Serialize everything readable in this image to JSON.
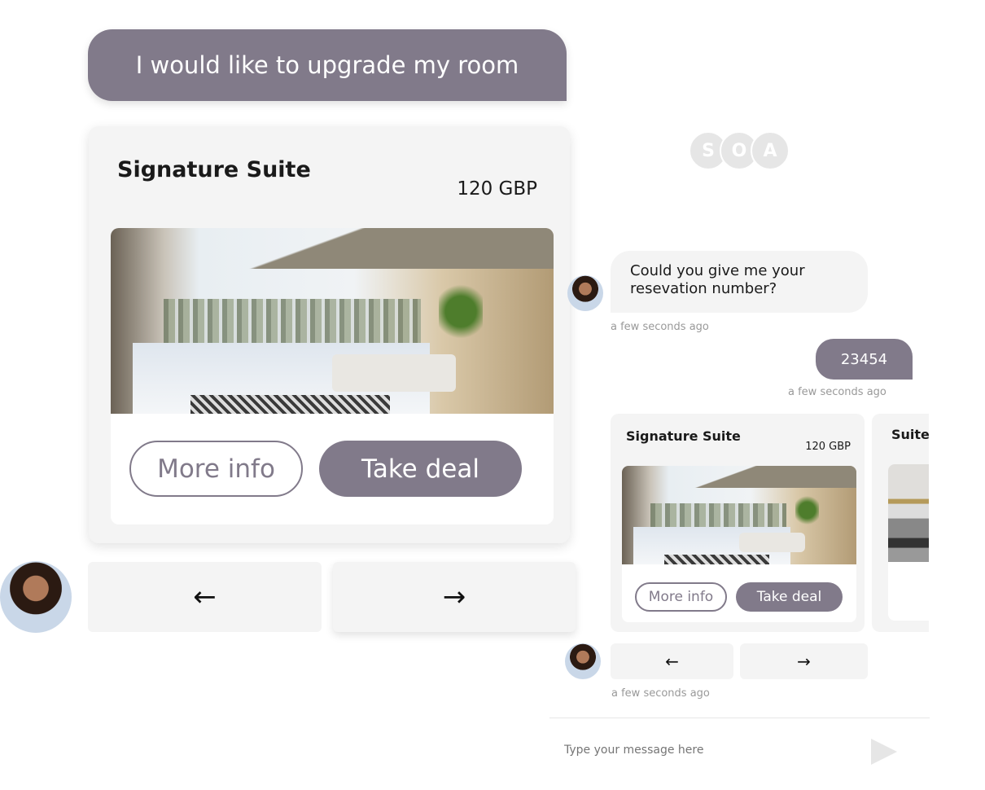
{
  "left": {
    "user_message": "I would like to upgrade my room",
    "card": {
      "title": "Signature Suite",
      "price": "120 GBP",
      "more_info": "More info",
      "take_deal": "Take deal"
    },
    "prev_arrow": "←",
    "next_arrow": "→"
  },
  "chat": {
    "logo_letters": [
      "S",
      "O",
      "A"
    ],
    "bot_message": "Could you give me your resevation number?",
    "bot_time": "a few seconds ago",
    "user_reply": "23454",
    "user_time": "a few seconds ago",
    "cards": [
      {
        "title": "Signature Suite",
        "price": "120 GBP",
        "more_info": "More info",
        "take_deal": "Take deal"
      },
      {
        "title": "Suite"
      }
    ],
    "prev_arrow": "←",
    "next_arrow": "→",
    "carousel_time": "a few seconds ago",
    "input_placeholder": "Type your message here"
  },
  "colors": {
    "accent": "#817a8a",
    "card_bg": "#f4f4f4"
  }
}
